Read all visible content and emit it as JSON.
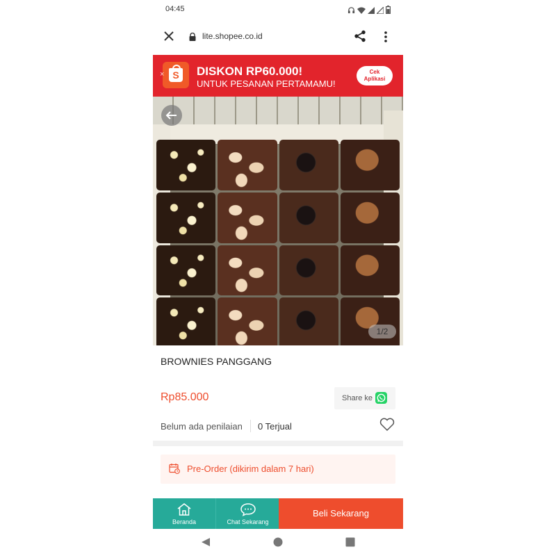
{
  "status_bar": {
    "time": "04:45"
  },
  "browser": {
    "url": "lite.shopee.co.id"
  },
  "banner": {
    "title": "DISKON RP60.000!",
    "subtitle": "UNTUK PESANAN PERTAMAMU!",
    "cta_line1": "Cek",
    "cta_line2": "Aplikasi",
    "logo_letter": "S",
    "close": "×"
  },
  "gallery": {
    "counter": "1/2"
  },
  "product": {
    "title": "BROWNIES PANGGANG",
    "price": "Rp85.000",
    "share_label": "Share ke",
    "rating_text": "Belum ada penilaian",
    "sold_text": "0 Terjual"
  },
  "preorder": {
    "text": "Pre-Order (dikirim dalam 7 hari)"
  },
  "bottom_bar": {
    "home_label": "Beranda",
    "chat_label": "Chat Sekarang",
    "buy_label": "Beli Sekarang"
  },
  "colors": {
    "brand": "#ee4d2d",
    "banner": "#e2242c",
    "teal": "#26aa99"
  },
  "icons": [
    "close-icon",
    "lock-icon",
    "share-icon",
    "more-vert-icon",
    "back-arrow-icon",
    "whatsapp-icon",
    "heart-icon",
    "calendar-icon",
    "home-icon",
    "chat-icon"
  ]
}
